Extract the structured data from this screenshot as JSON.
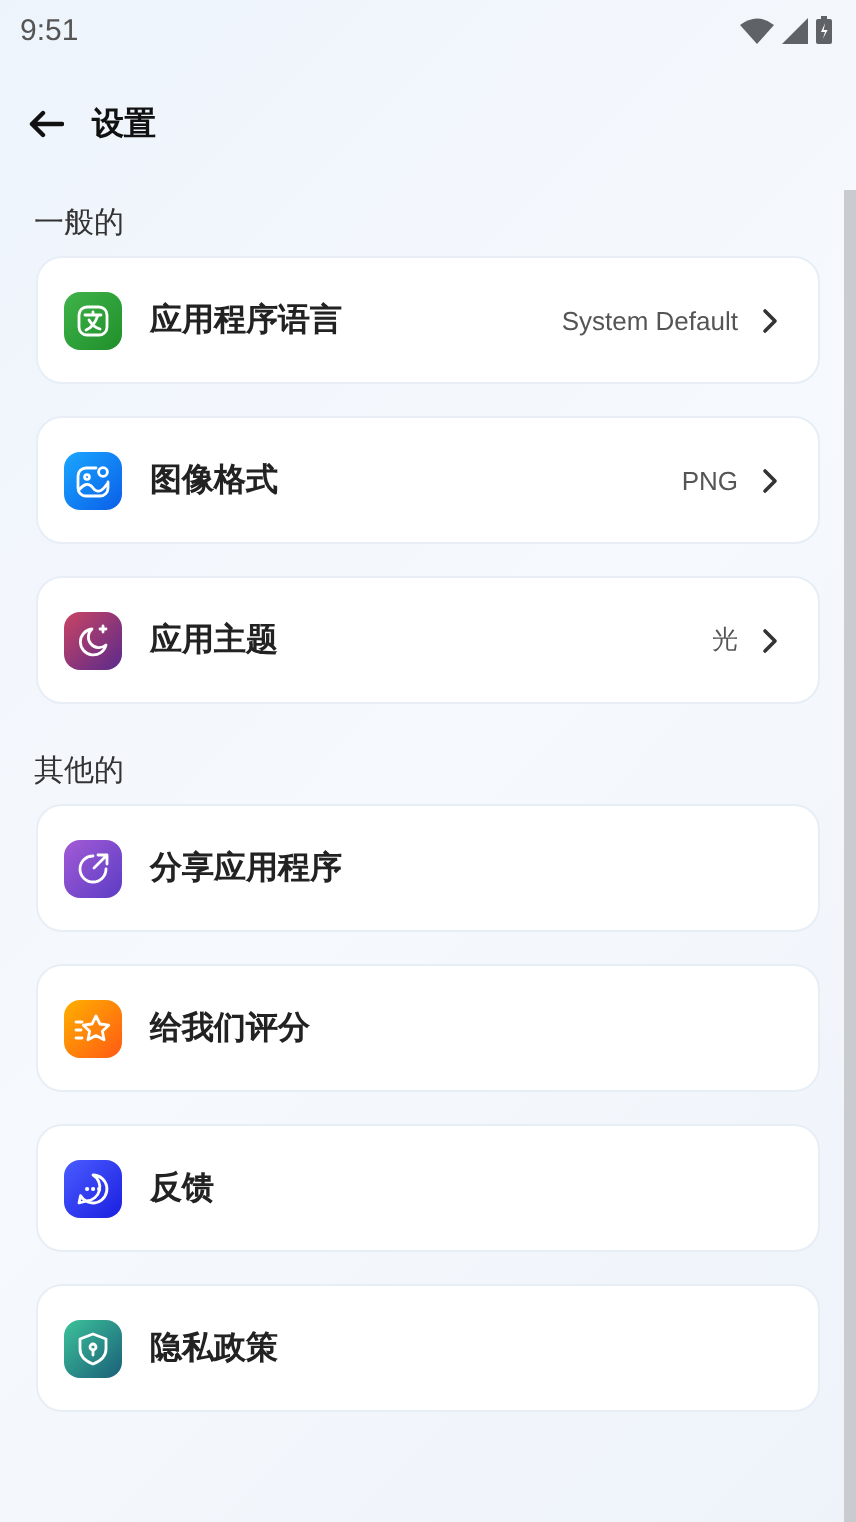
{
  "status_bar": {
    "time": "9:51"
  },
  "header": {
    "title": "设置"
  },
  "sections": [
    {
      "title": "一般的",
      "items": [
        {
          "kind": "value",
          "label": "应用程序语言",
          "value": "System Default"
        },
        {
          "kind": "value",
          "label": "图像格式",
          "value": "PNG"
        },
        {
          "kind": "value",
          "label": "应用主题",
          "value": "光"
        }
      ]
    },
    {
      "title": "其他的",
      "items": [
        {
          "kind": "link",
          "label": "分享应用程序"
        },
        {
          "kind": "link",
          "label": "给我们评分"
        },
        {
          "kind": "link",
          "label": "反馈"
        },
        {
          "kind": "link",
          "label": "隐私政策"
        }
      ]
    }
  ]
}
